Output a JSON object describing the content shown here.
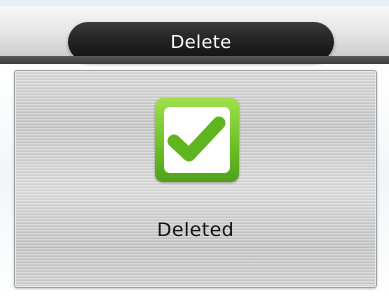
{
  "window": {
    "title": "Delete"
  },
  "dialog": {
    "icon": "checkmark-icon",
    "message": "Deleted"
  },
  "colors": {
    "title_pill": "#1f1f1f",
    "check_green": "#6fc126",
    "panel_metal": "#cfcfcf"
  }
}
